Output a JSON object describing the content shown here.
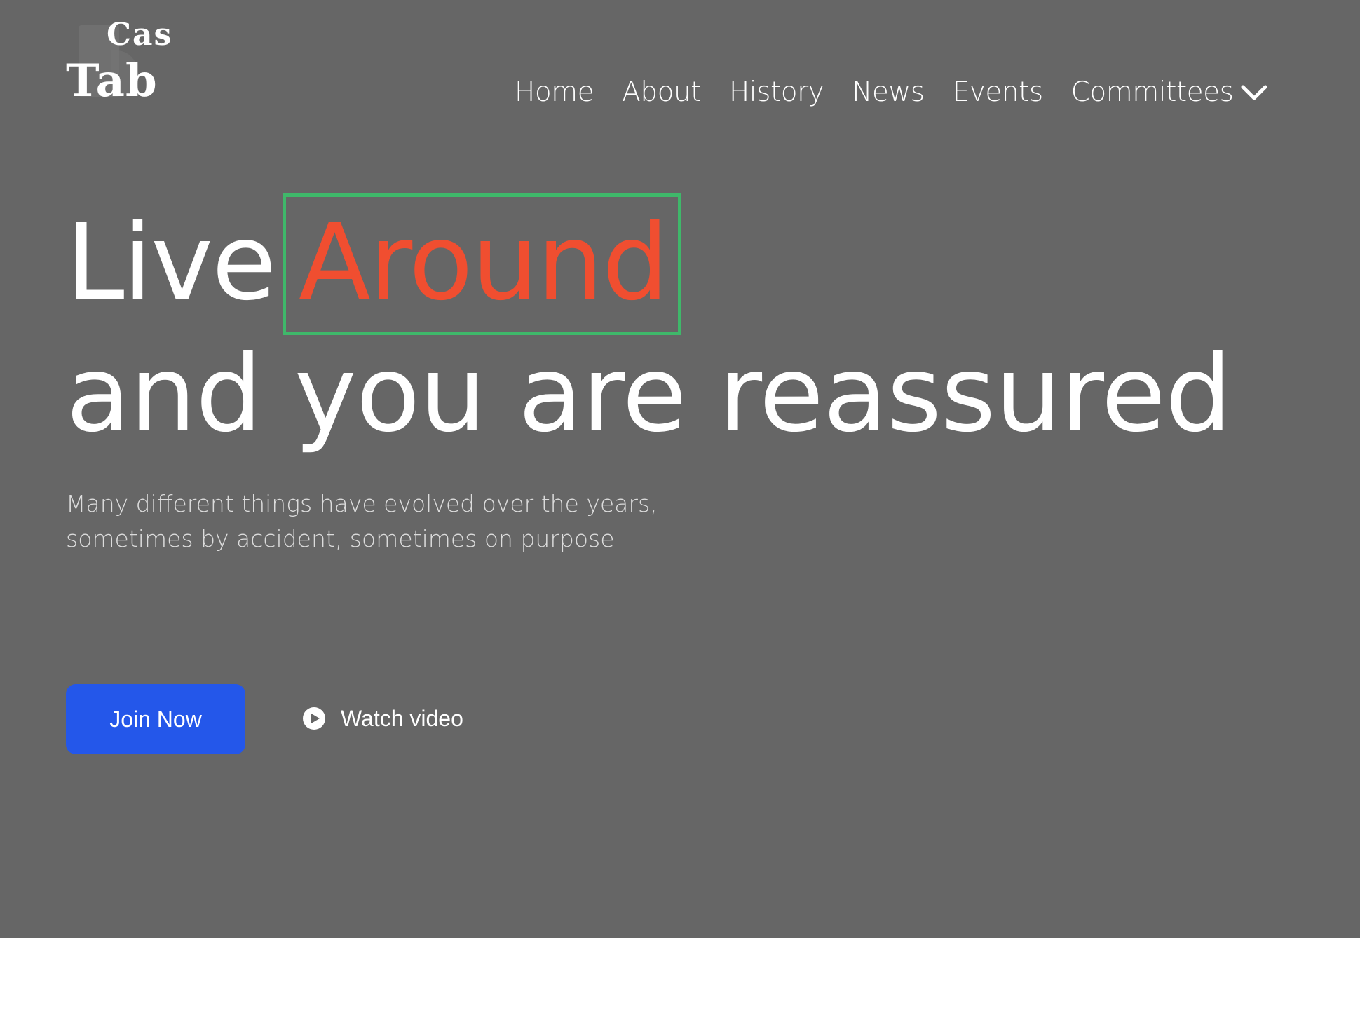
{
  "logo": {
    "line1": "Cas",
    "line2": "Tab"
  },
  "nav": {
    "items": [
      {
        "label": "Home"
      },
      {
        "label": "About"
      },
      {
        "label": "History"
      },
      {
        "label": "News"
      },
      {
        "label": "Events"
      },
      {
        "label": "Committees",
        "icon": "chevron-down-icon"
      }
    ]
  },
  "hero": {
    "headline_word1": "Live",
    "headline_accent": "Around",
    "headline_line2": "and you are reassured",
    "subtitle_line1": "Many different things have evolved over the years,",
    "subtitle_line2": "sometimes by accident, sometimes on purpose",
    "primary_button": "Join Now",
    "secondary_button": "Watch video",
    "secondary_icon": "play-icon"
  },
  "colors": {
    "hero_background": "#666666",
    "accent_text": "#f04e30",
    "accent_box": "#3fb86a",
    "primary_button": "#2457ea",
    "page_background": "#ffffff"
  }
}
